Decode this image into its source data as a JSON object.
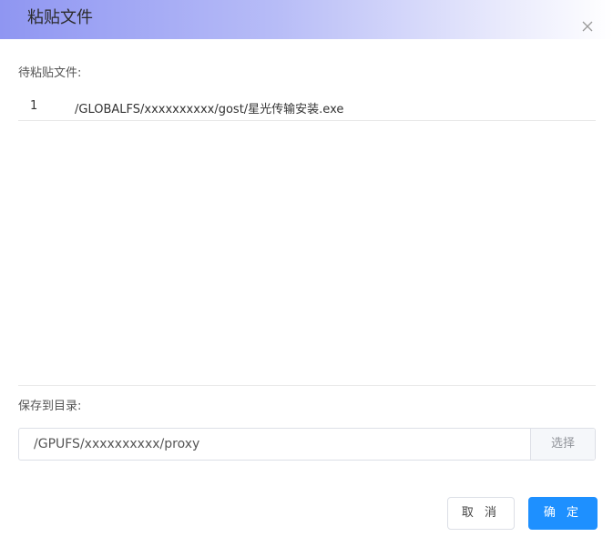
{
  "dialog": {
    "title": "粘贴文件",
    "close_icon": "close-icon"
  },
  "paste_files": {
    "label": "待粘贴文件:",
    "items": [
      {
        "index": "1",
        "path": "/GLOBALFS/xxxxxxxxxx/gost/星光传输安装.exe"
      }
    ]
  },
  "save_to": {
    "label": "保存到目录:",
    "path_value": "/GPUFS/xxxxxxxxxx/proxy",
    "select_label": "选择"
  },
  "footer": {
    "cancel_label": "取 消",
    "ok_label": "确 定"
  },
  "colors": {
    "primary": "#1e90ff",
    "header_gradient_start": "#8f96f2"
  }
}
